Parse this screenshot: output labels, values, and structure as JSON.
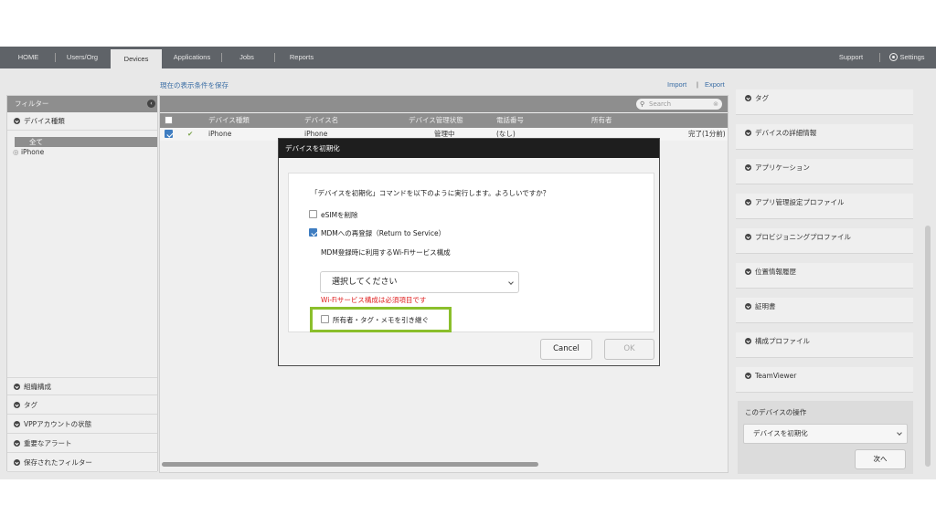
{
  "nav": {
    "tabs": [
      "HOME",
      "Users/Org",
      "Devices",
      "Applications",
      "Jobs",
      "Reports"
    ],
    "support": "Support",
    "settings": "Settings"
  },
  "links": {
    "save_filter": "現在の表示条件を保存",
    "import": "Import",
    "separator": "|",
    "export": "Export"
  },
  "filter": {
    "header": "フィルター",
    "device_type": "デバイス種類",
    "items": [
      "全て",
      "iPhone"
    ],
    "sections": [
      "組織構成",
      "タグ",
      "VPPアカウントの状態",
      "重要なアラート",
      "保存されたフィルター"
    ]
  },
  "table": {
    "search_placeholder": "Search",
    "columns": [
      "デバイス種類",
      "デバイス名",
      "デバイス管理状態",
      "電話番号",
      "所有者"
    ],
    "rows": [
      {
        "type": "iPhone",
        "name": "iPhone",
        "state": "管理中",
        "phone": "(なし)",
        "status": "完了(1分前)"
      }
    ]
  },
  "right": {
    "sections": [
      "タグ",
      "デバイスの詳細情報",
      "アプリケーション",
      "アプリ管理設定プロファイル",
      "プロビジョニングプロファイル",
      "位置情報履歴",
      "証明書",
      "構成プロファイル",
      "TeamViewer"
    ],
    "ops_title": "このデバイスの操作",
    "ops_select": "デバイスを初期化",
    "next_button": "次へ"
  },
  "modal": {
    "title": "デバイスを初期化",
    "prompt": "「デバイスを初期化」コマンドを以下のように実行します。よろしいですか？",
    "esim_label": "eSIMを削除",
    "esim_checked": false,
    "mdm_label": "MDMへの再登録（Return to Service）",
    "mdm_checked": true,
    "wifi_label": "MDM登録時に利用するWi-Fiサービス構成",
    "select_value": "選択してください",
    "error": "Wi-Fiサービス構成は必須項目です",
    "inherit_label": "所有者・タグ・メモを引き継ぐ",
    "inherit_checked": false,
    "cancel": "Cancel",
    "ok": "OK"
  },
  "colors": {
    "accent": "#3f7dc1",
    "error": "#e02020",
    "highlight": "#8bbf2c",
    "nav_bg": "#5f6368"
  }
}
